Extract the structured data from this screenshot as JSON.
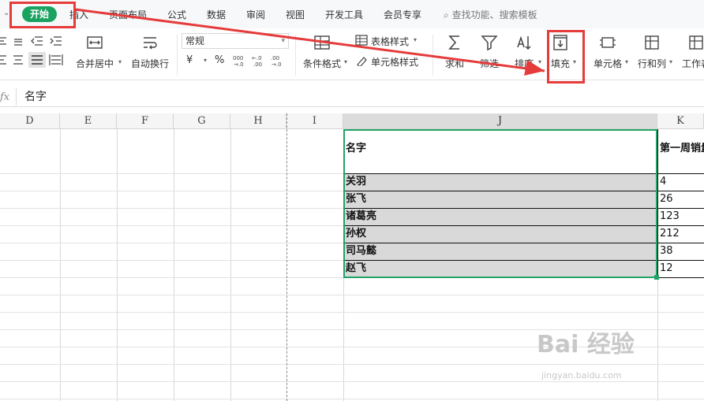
{
  "tabs": {
    "home": "开始",
    "insert": "插入",
    "page_layout": "页面布局",
    "formulas": "公式",
    "data": "数据",
    "review": "审阅",
    "view": "视图",
    "developer": "开发工具",
    "member": "会员专享",
    "search": "查找功能、搜索模板"
  },
  "ribbon": {
    "merge_center": "合并居中",
    "wrap_text": "自动换行",
    "number_format": "常规",
    "currency": "¥",
    "percent": "%",
    "conditional_format": "条件格式",
    "table_style": "表格样式",
    "cell_style": "单元格样式",
    "sum": "求和",
    "filter": "筛选",
    "sort": "排序",
    "fill": "填充",
    "cell": "单元格",
    "rows_cols": "行和列",
    "worksheet": "工作表"
  },
  "formula_bar": {
    "fx_label": "fx",
    "content": "名字"
  },
  "columns": [
    "D",
    "E",
    "F",
    "G",
    "H",
    "I",
    "J",
    "K"
  ],
  "table": {
    "header_name": "名字",
    "header_week1": "第一周销量",
    "rows": [
      {
        "name": "关羽",
        "value": "4"
      },
      {
        "name": "张飞",
        "value": "26"
      },
      {
        "name": "诸葛亮",
        "value": "123"
      },
      {
        "name": "孙权",
        "value": "212"
      },
      {
        "name": "司马懿",
        "value": "38"
      },
      {
        "name": "赵飞",
        "value": "12"
      }
    ]
  },
  "watermark": {
    "brand": "Bai  经验",
    "url": "jingyan.baidu.com"
  },
  "colors": {
    "accent_green": "#1aa260",
    "selection_green": "#21a366",
    "annotation_red": "#e53b3b"
  }
}
